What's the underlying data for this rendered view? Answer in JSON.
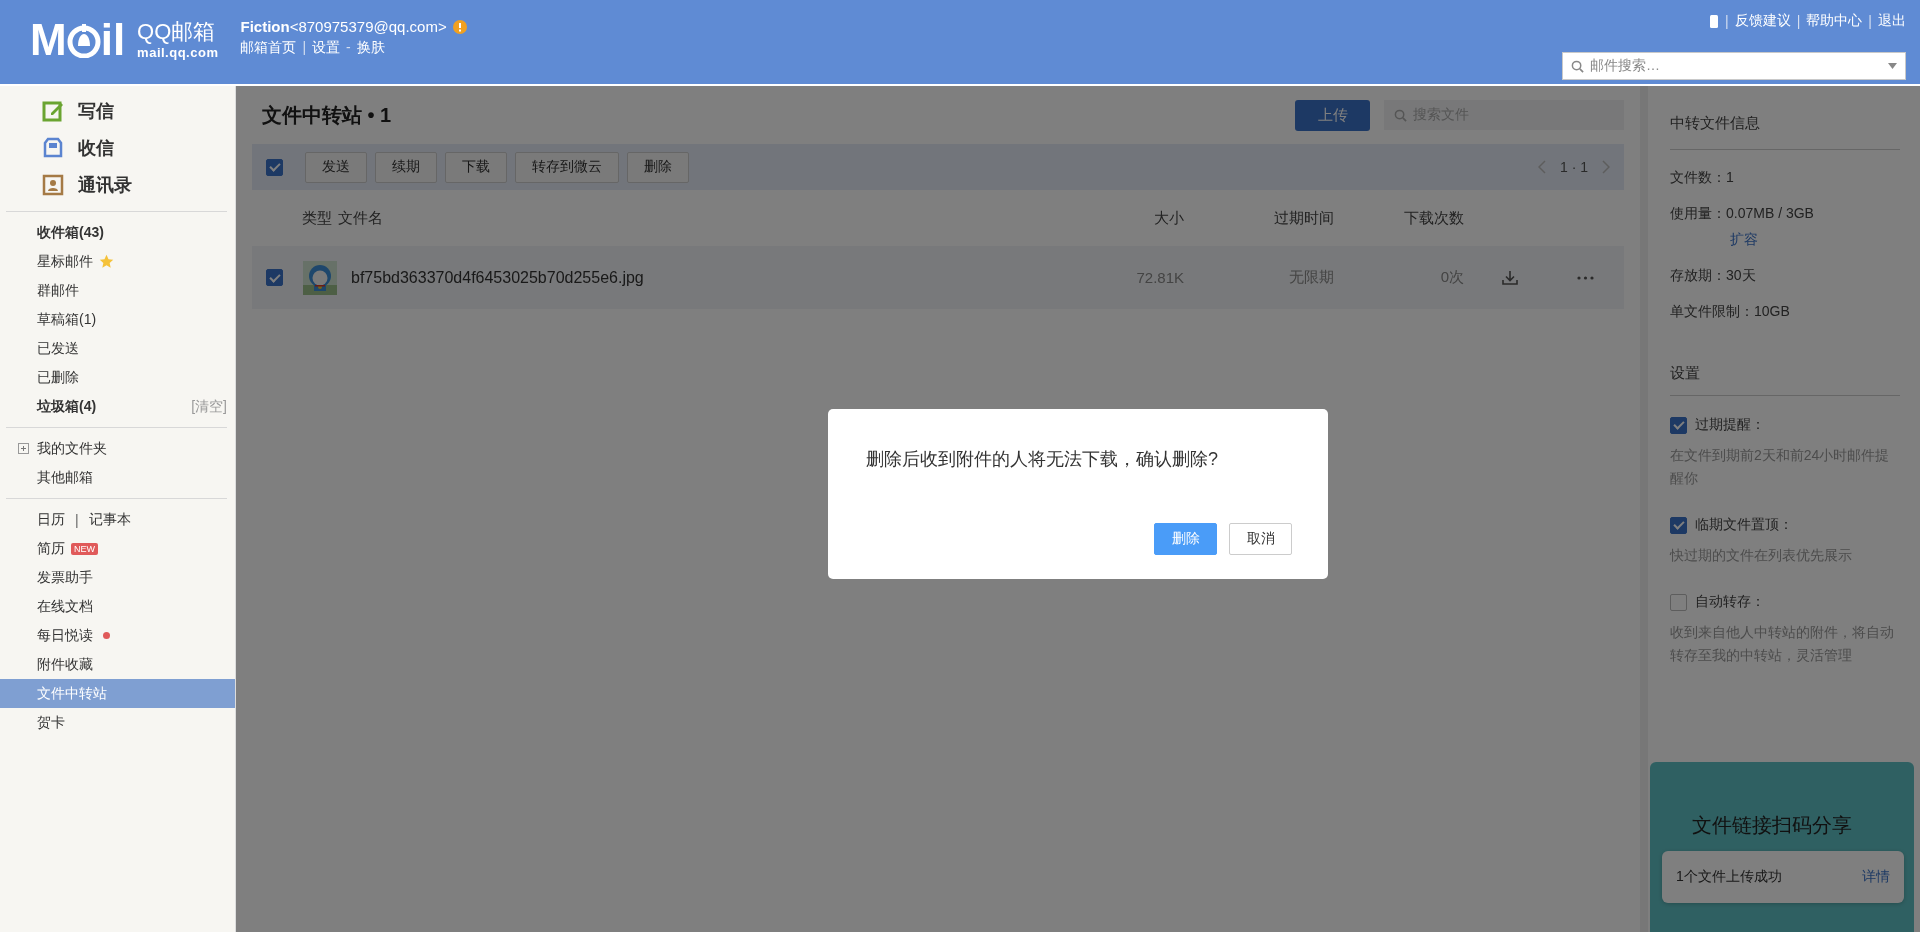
{
  "header": {
    "logo": {
      "left": "M",
      "right": "il",
      "product": "QQ邮箱",
      "domain": "mail.qq.com"
    },
    "account": "**Fiction**<870975379@qq.com>",
    "nav": [
      {
        "text": "邮箱首页",
        "kind": "link"
      },
      {
        "text": "|",
        "kind": "sep"
      },
      {
        "text": "设置",
        "kind": "link"
      },
      {
        "text": "-",
        "kind": "sep"
      },
      {
        "text": "换肤",
        "kind": "link"
      }
    ],
    "top_links": [
      {
        "text": "|",
        "kind": "sep"
      },
      {
        "text": "反馈建议",
        "kind": "link"
      },
      {
        "text": "|",
        "kind": "sep"
      },
      {
        "text": "帮助中心",
        "kind": "link"
      },
      {
        "text": "|",
        "kind": "sep"
      },
      {
        "text": "退出",
        "kind": "link"
      }
    ],
    "search": {
      "placeholder": "邮件搜索…"
    }
  },
  "sidebar": {
    "compose": [
      {
        "label": "写信",
        "kind": "write"
      },
      {
        "label": "收信",
        "kind": "inbox"
      },
      {
        "label": "通讯录",
        "kind": "contacts"
      }
    ],
    "groups": [
      [
        {
          "label": "收件箱(43)",
          "kind": "plain",
          "bold": true,
          "selected": false
        },
        {
          "label": "星标邮件",
          "kind": "star",
          "bold": false,
          "selected": false
        },
        {
          "label": "群邮件",
          "kind": "plain",
          "bold": false,
          "selected": false
        },
        {
          "label": "草稿箱(1)",
          "kind": "plain",
          "bold": false,
          "selected": false
        },
        {
          "label": "已发送",
          "kind": "plain",
          "bold": false,
          "selected": false
        },
        {
          "label": "已删除",
          "kind": "plain",
          "bold": false,
          "selected": false
        },
        {
          "label": "垃圾箱(4)",
          "kind": "clear",
          "action": "[清空]",
          "bold": true,
          "selected": false
        }
      ],
      [
        {
          "label": "我的文件夹",
          "kind": "expand",
          "bold": false,
          "selected": false
        },
        {
          "label": "其他邮箱",
          "kind": "plain",
          "bold": false,
          "selected": false
        }
      ],
      [
        {
          "label": "日历",
          "kind": "pair",
          "sep": "|",
          "label2": "记事本",
          "bold": false,
          "selected": false
        },
        {
          "label": "简历",
          "kind": "badge",
          "badge": "NEW",
          "bold": false,
          "selected": false
        },
        {
          "label": "发票助手",
          "kind": "plain",
          "bold": false,
          "selected": false
        },
        {
          "label": "在线文档",
          "kind": "plain",
          "bold": false,
          "selected": false
        },
        {
          "label": "每日悦读",
          "kind": "dot",
          "bold": false,
          "selected": false
        },
        {
          "label": "附件收藏",
          "kind": "plain",
          "bold": false,
          "selected": false
        },
        {
          "label": "文件中转站",
          "kind": "plain",
          "bold": false,
          "selected": true
        },
        {
          "label": "贺卡",
          "kind": "plain",
          "bold": false,
          "selected": false
        }
      ]
    ]
  },
  "main": {
    "title": "文件中转站 • 1",
    "upload": "上传",
    "search": {
      "placeholder": "搜索文件"
    },
    "toolbar": {
      "checked": true,
      "buttons": [
        "发送",
        "续期",
        "下载",
        "转存到微云",
        "删除"
      ],
      "pager": "1 · 1"
    },
    "columns": [
      "类型",
      "文件名",
      "大小",
      "过期时间",
      "下载次数"
    ],
    "rows": [
      {
        "checked": true,
        "name": "bf75bd363370d4f6453025b70d255e6.jpg",
        "size": "72.81K",
        "expiry": "无限期",
        "downloads": "0次"
      }
    ]
  },
  "info": {
    "title": "中转文件信息",
    "rows": [
      {
        "label": "文件数：",
        "value": "1"
      },
      {
        "label": "使用量：",
        "value": "0.07MB / 3GB",
        "link": "扩容"
      },
      {
        "label": "存放期：",
        "value": "30天"
      },
      {
        "label": "单文件限制：",
        "value": "10GB"
      }
    ],
    "settings_title": "设置",
    "settings": [
      {
        "label": "过期提醒：",
        "checked": true,
        "desc": "在文件到期前2天和前24小时邮件提醒你"
      },
      {
        "label": "临期文件置顶：",
        "checked": true,
        "desc": "快过期的文件在列表优先展示"
      },
      {
        "label": "自动转存：",
        "checked": false,
        "desc": "收到来自他人中转站的附件，将自动转存至我的中转站，灵活管理"
      }
    ]
  },
  "promo": {
    "title": "文件链接扫码分享",
    "toast": "1个文件上传成功",
    "toast_link": "详情"
  },
  "dialog": {
    "message": "删除后收到附件的人将无法下载，确认删除?",
    "buttons": [
      {
        "label": "删除",
        "kind": "primary"
      },
      {
        "label": "取消",
        "kind": "secondary"
      }
    ]
  }
}
